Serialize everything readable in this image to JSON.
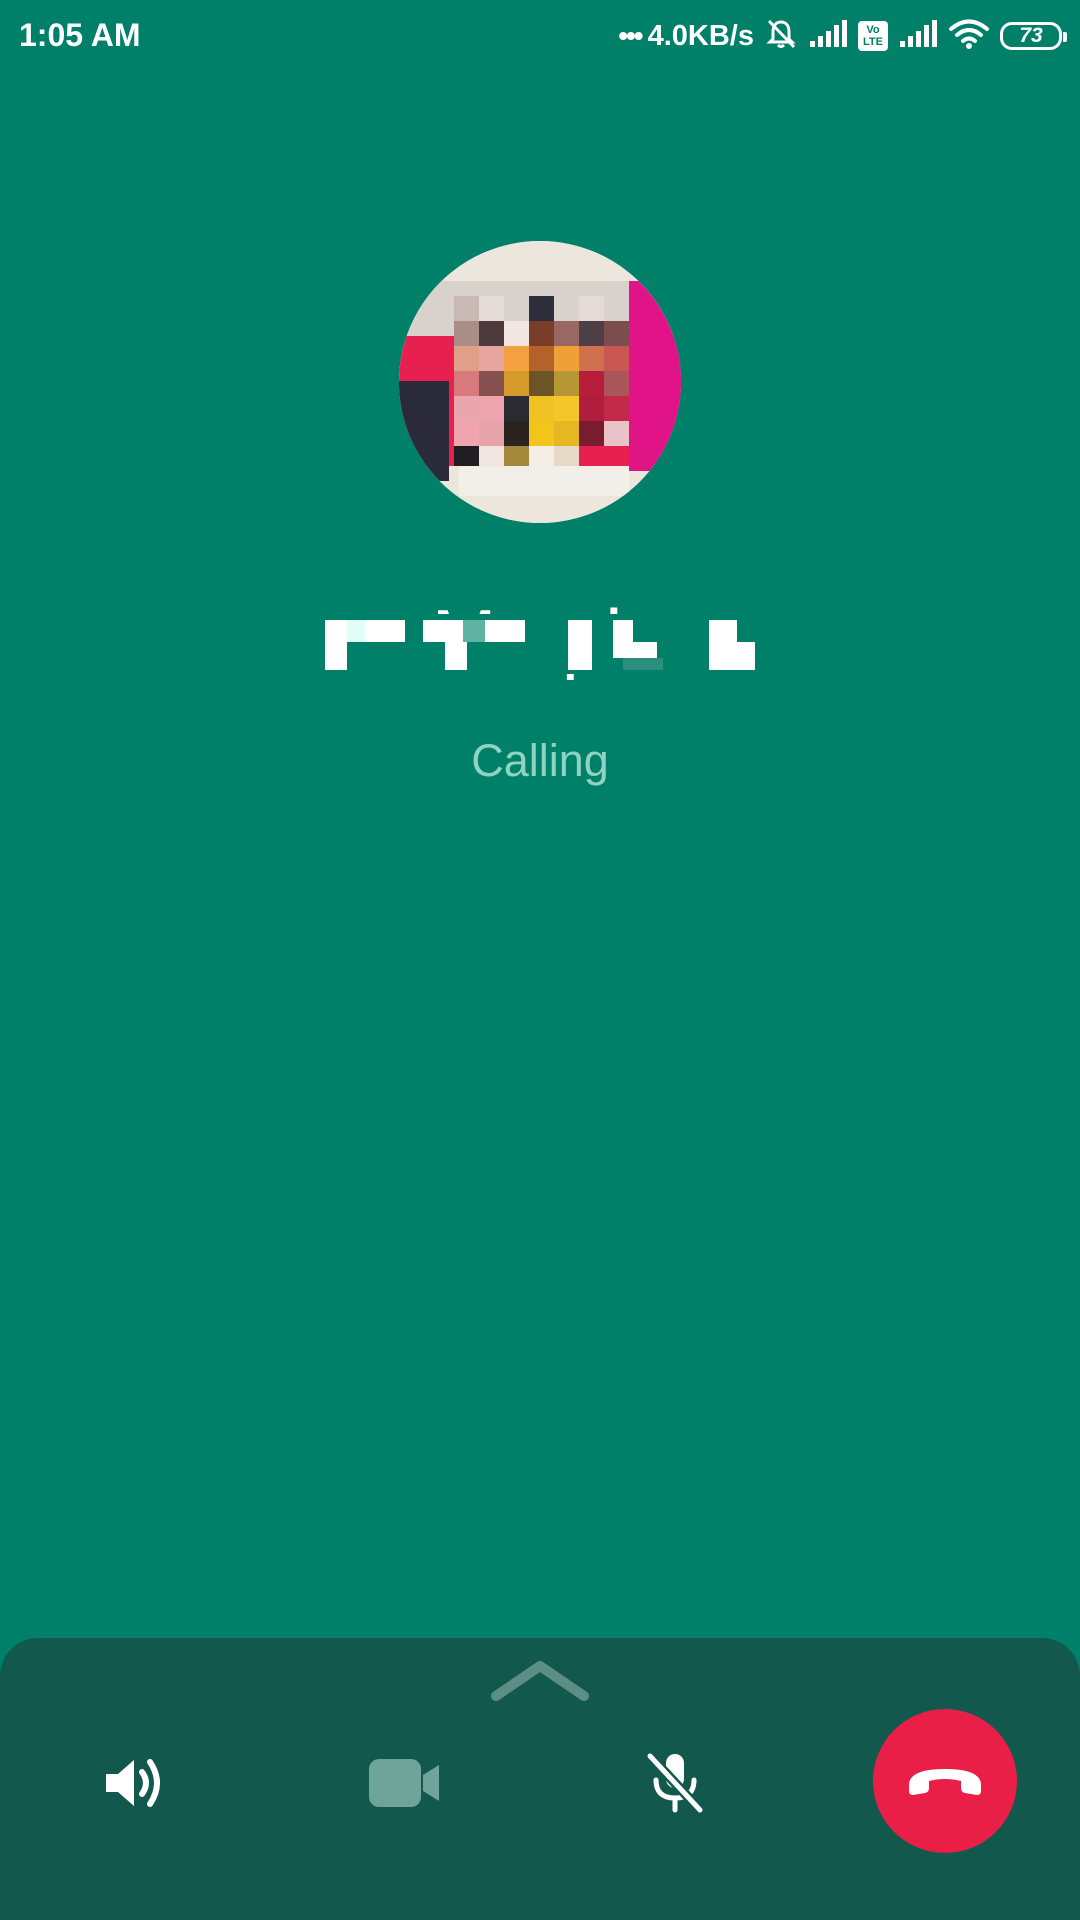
{
  "status_bar": {
    "time": "1:05 AM",
    "network_dots": "•••",
    "network_speed": "4.0KB/s",
    "volte_label": "Vo\nLTE",
    "battery_level": "73",
    "icons": [
      "mute-bell-icon",
      "signal-icon",
      "volte-icon",
      "signal-icon",
      "wifi-icon",
      "battery-icon"
    ]
  },
  "call": {
    "contact_name": "Mu                                          ph",
    "status": "Calling"
  },
  "controls": {
    "expand_icon": "chevron-up-icon",
    "speaker_icon": "speaker-icon",
    "video_icon": "video-camera-icon",
    "mute_icon": "microphone-off-icon",
    "end_call_icon": "end-call-icon"
  },
  "colors": {
    "background": "#008069",
    "sheet": "#12584d",
    "end_call": "#ea1f48",
    "status_text": "#8fd3c2"
  }
}
